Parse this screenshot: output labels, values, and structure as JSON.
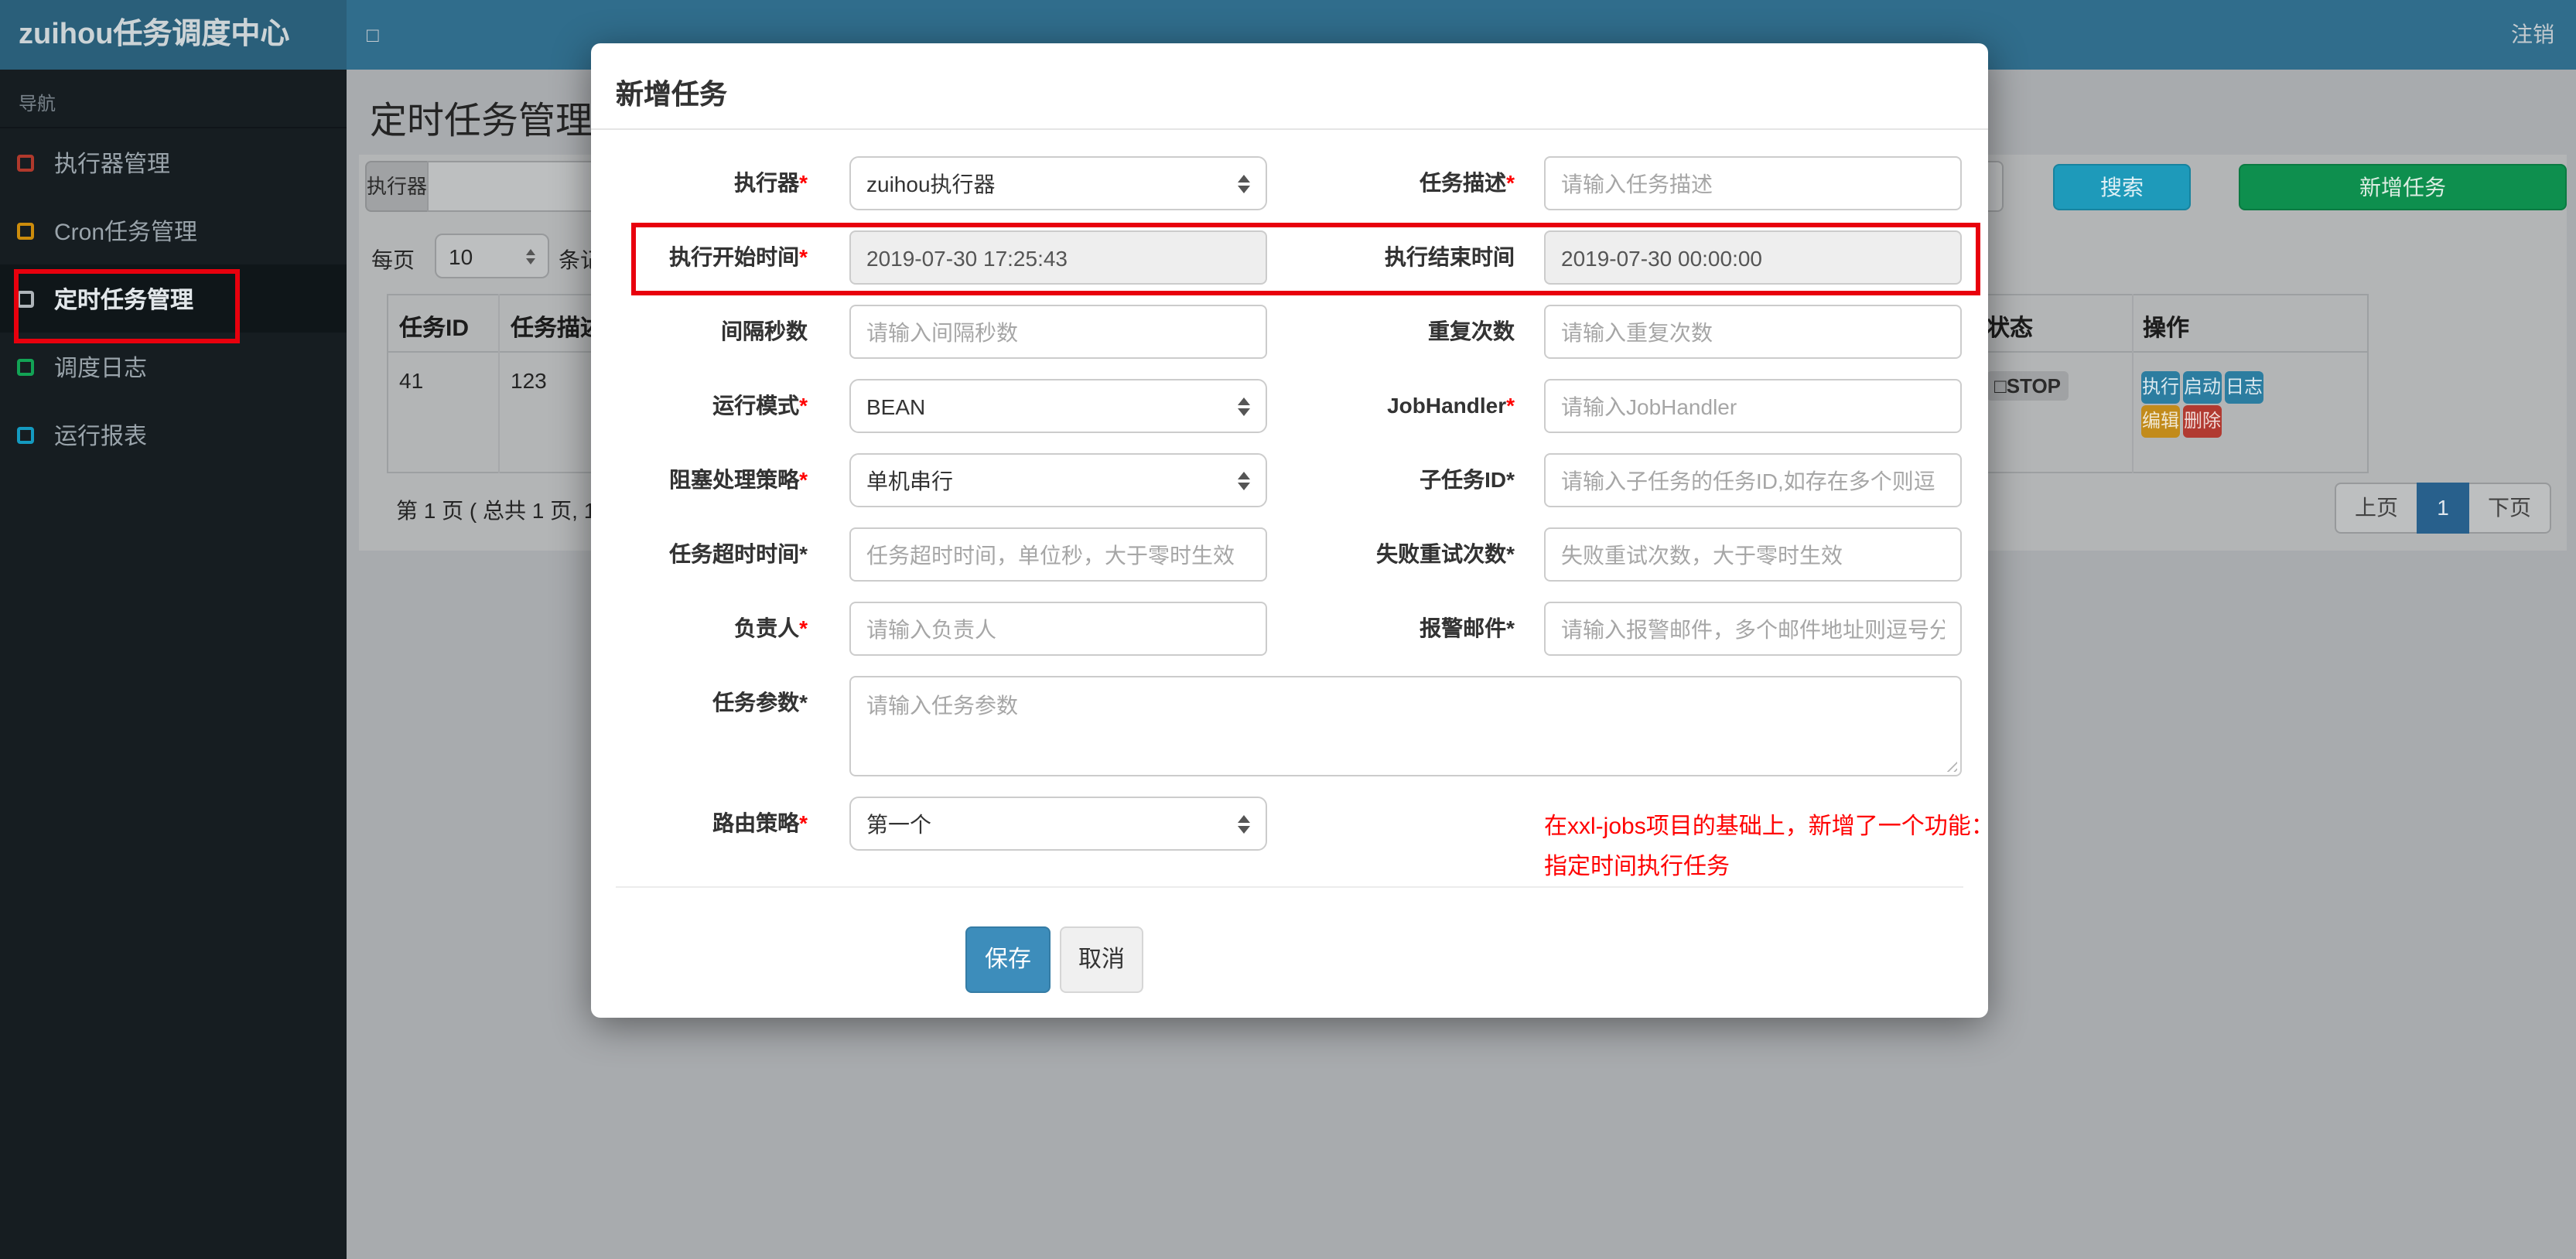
{
  "topbar": {
    "brand": "zuihou任务调度中心",
    "toggle_icon": "□",
    "logout": "注销"
  },
  "sidebar": {
    "section": "导航",
    "items": [
      {
        "label": "执行器管理",
        "icon_color": "#b0392c",
        "active": false
      },
      {
        "label": "Cron任务管理",
        "icon_color": "#cc8c0c",
        "active": false
      },
      {
        "label": "定时任务管理",
        "icon_color": "#aeb4b9",
        "active": true
      },
      {
        "label": "调度日志",
        "icon_color": "#12a355",
        "active": false
      },
      {
        "label": "运行报表",
        "icon_color": "#149ac0",
        "active": false
      }
    ]
  },
  "content": {
    "page_title": "定时任务管理",
    "filter_addon": "执行器",
    "search_button": "搜索",
    "add_button": "新增任务",
    "per_page": {
      "prefix": "每页",
      "value": "10",
      "suffix": "条记"
    },
    "table": {
      "headers": {
        "task_id": "任务ID",
        "task_desc": "任务描述",
        "status": "状态",
        "actions": "操作"
      },
      "row": {
        "task_id": "41",
        "task_desc": "123",
        "status": "□STOP",
        "actions": {
          "run": "执行",
          "start": "启动",
          "log": "日志",
          "edit": "编辑",
          "delete": "删除"
        }
      }
    },
    "pagination": {
      "info": "第 1 页 ( 总共 1 页, 1",
      "prev": "上页",
      "page": "1",
      "next": "下页"
    }
  },
  "modal": {
    "title": "新增任务",
    "rows": [
      {
        "left": {
          "label": "执行器",
          "star": "*",
          "star_class": "star red",
          "type": "select",
          "value": "zuihou执行器"
        },
        "right": {
          "label": "任务描述",
          "star": "*",
          "star_class": "star red",
          "type": "input",
          "placeholder": "请输入任务描述"
        }
      },
      {
        "left": {
          "label": "执行开始时间",
          "star": "*",
          "star_class": "star red",
          "type": "readonly",
          "value": "2019-07-30 17:25:43"
        },
        "right": {
          "label": "执行结束时间",
          "star": "",
          "star_class": "star",
          "type": "readonly",
          "value": "2019-07-30 00:00:00"
        }
      },
      {
        "left": {
          "label": "间隔秒数",
          "star": "",
          "star_class": "star",
          "type": "input",
          "placeholder": "请输入间隔秒数"
        },
        "right": {
          "label": "重复次数",
          "star": "",
          "star_class": "star",
          "type": "input",
          "placeholder": "请输入重复次数"
        }
      },
      {
        "left": {
          "label": "运行模式",
          "star": "*",
          "star_class": "star red",
          "type": "select",
          "value": "BEAN"
        },
        "right": {
          "label": "JobHandler",
          "star": "*",
          "star_class": "star red",
          "type": "input",
          "placeholder": "请输入JobHandler"
        }
      },
      {
        "left": {
          "label": "阻塞处理策略",
          "star": "*",
          "star_class": "star red",
          "type": "select",
          "value": "单机串行"
        },
        "right": {
          "label": "子任务ID",
          "star": "*",
          "star_class": "star",
          "type": "input",
          "placeholder": "请输入子任务的任务ID,如存在多个则逗"
        }
      },
      {
        "left": {
          "label": "任务超时时间",
          "star": "*",
          "star_class": "star",
          "type": "input",
          "placeholder": "任务超时时间，单位秒，大于零时生效"
        },
        "right": {
          "label": "失败重试次数",
          "star": "*",
          "star_class": "star",
          "type": "input",
          "placeholder": "失败重试次数，大于零时生效"
        }
      },
      {
        "left": {
          "label": "负责人",
          "star": "*",
          "star_class": "star red",
          "type": "input",
          "placeholder": "请输入负责人"
        },
        "right": {
          "label": "报警邮件",
          "star": "*",
          "star_class": "star",
          "type": "input",
          "placeholder": "请输入报警邮件，多个邮件地址则逗号分"
        }
      }
    ],
    "textarea_row": {
      "label": "任务参数",
      "star": "*",
      "star_class": "star",
      "placeholder": "请输入任务参数"
    },
    "route_row": {
      "label": "路由策略",
      "star": "*",
      "star_class": "star red",
      "value": "第一个"
    },
    "note_line1": "在xxl-jobs项目的基础上，新增了一个功能：",
    "note_line2": "指定时间执行任务",
    "save_button": "保存",
    "cancel_button": "取消"
  },
  "colors": {
    "topbar": "#306d8c",
    "logo_panel": "#2a5f7a",
    "sidebar": "#161d21",
    "annotation_red": "#e8000d",
    "search_button": "#1e9aba",
    "add_button": "#0e8f4e",
    "save_button": "#3d8dbb",
    "pager_active": "#28608c"
  }
}
